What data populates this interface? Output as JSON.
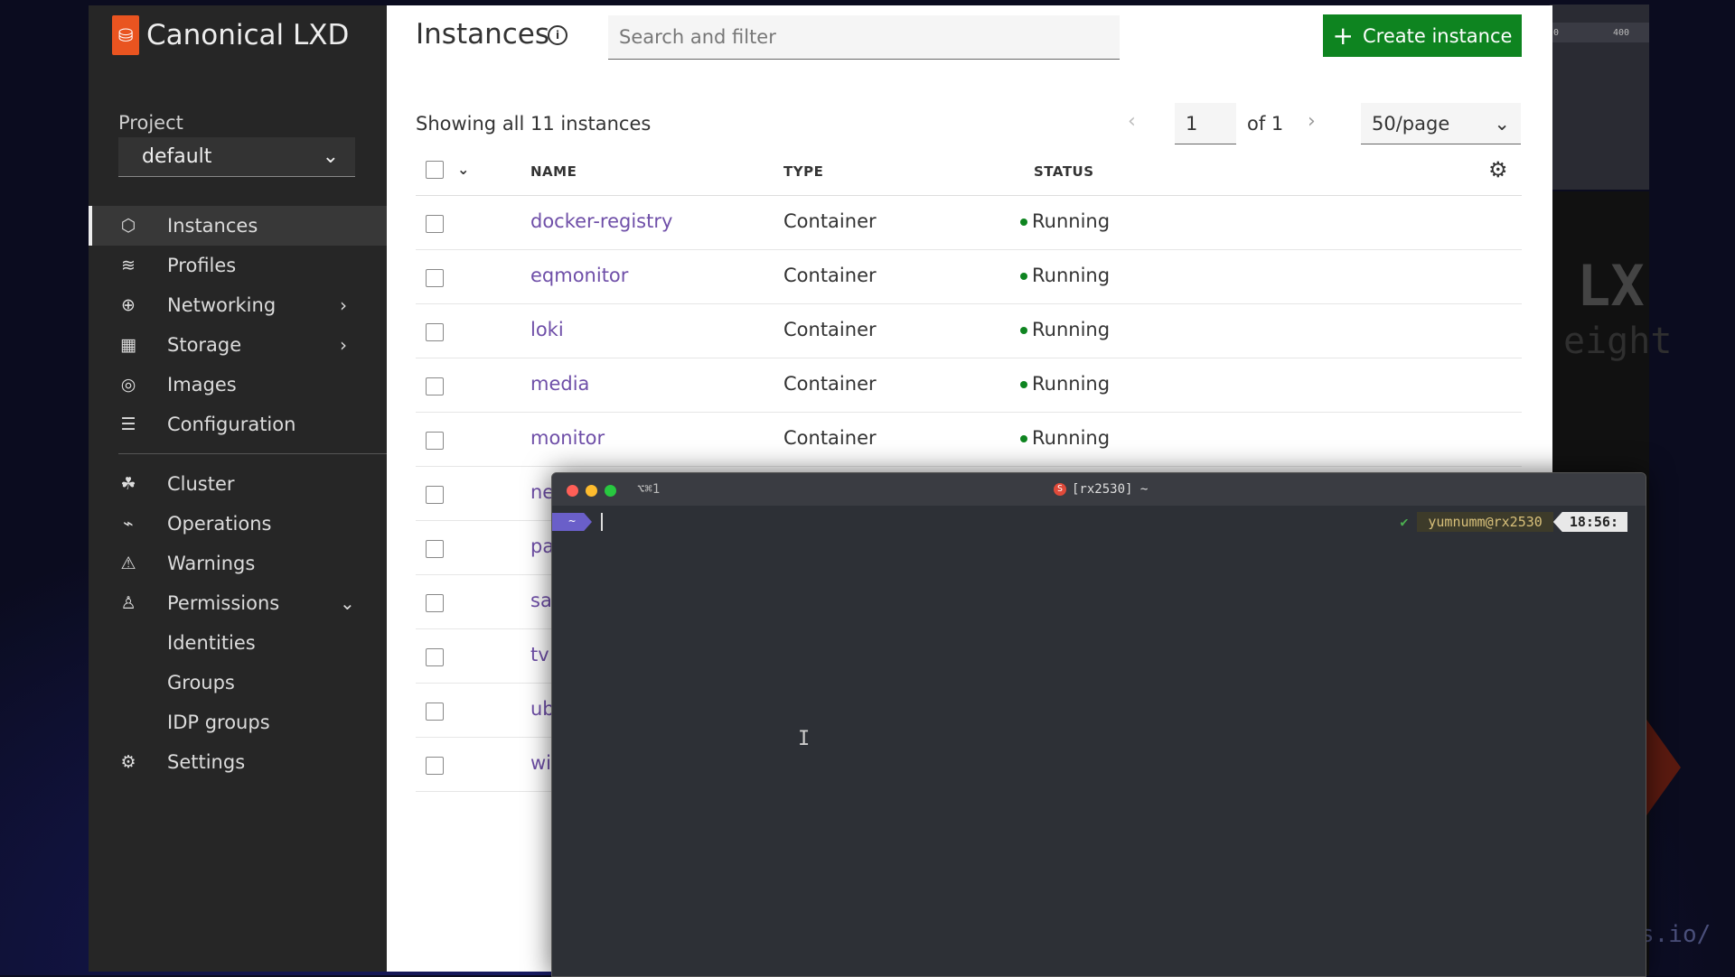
{
  "sidebar": {
    "brand": "Canonical LXD",
    "project_label": "Project",
    "project_value": "default",
    "items": [
      {
        "label": "Instances",
        "icon": "instances-icon",
        "glyph": "⬡",
        "active": true
      },
      {
        "label": "Profiles",
        "icon": "profiles-icon",
        "glyph": "≋"
      },
      {
        "label": "Networking",
        "icon": "networking-icon",
        "glyph": "⊕",
        "chevron": "›"
      },
      {
        "label": "Storage",
        "icon": "storage-icon",
        "glyph": "▦",
        "chevron": "›"
      },
      {
        "label": "Images",
        "icon": "images-icon",
        "glyph": "◎"
      },
      {
        "label": "Configuration",
        "icon": "configuration-icon",
        "glyph": "☰"
      },
      {
        "label": "Cluster",
        "icon": "cluster-icon",
        "glyph": "☘"
      },
      {
        "label": "Operations",
        "icon": "operations-icon",
        "glyph": "⌁"
      },
      {
        "label": "Warnings",
        "icon": "warnings-icon",
        "glyph": "⚠"
      },
      {
        "label": "Permissions",
        "icon": "permissions-icon",
        "glyph": "♙",
        "chevron": "⌄"
      },
      {
        "label": "Identities"
      },
      {
        "label": "Groups"
      },
      {
        "label": "IDP groups"
      },
      {
        "label": "Settings",
        "icon": "settings-icon",
        "glyph": "⚙"
      }
    ]
  },
  "main": {
    "title": "Instances",
    "search_placeholder": "Search and filter",
    "create_label": "Create instance",
    "showing": "Showing all 11 instances",
    "page_value": "1",
    "page_of": "of 1",
    "per_page": "50/page",
    "columns": [
      "NAME",
      "TYPE",
      "STATUS"
    ],
    "rows": [
      {
        "name": "docker-registry",
        "type": "Container",
        "status": "Running"
      },
      {
        "name": "eqmonitor",
        "type": "Container",
        "status": "Running"
      },
      {
        "name": "loki",
        "type": "Container",
        "status": "Running"
      },
      {
        "name": "media",
        "type": "Container",
        "status": "Running"
      },
      {
        "name": "monitor",
        "type": "Container",
        "status": "Running"
      },
      {
        "name": "ne",
        "type": "",
        "status": ""
      },
      {
        "name": "pa",
        "type": "",
        "status": ""
      },
      {
        "name": "sa",
        "type": "",
        "status": ""
      },
      {
        "name": "tv",
        "type": "",
        "status": ""
      },
      {
        "name": "ub",
        "type": "",
        "status": ""
      },
      {
        "name": "wi",
        "type": "",
        "status": ""
      }
    ]
  },
  "terminal": {
    "shortcut": "⌥⌘1",
    "title": "[rx2530] ~",
    "prompt_dir": "~",
    "user_host": "yumnumm@rx2530",
    "time": "18:56:"
  },
  "background": {
    "ruler_left": "0",
    "ruler_right": "400",
    "overlay_lx": "LX",
    "overlay_eight": "eight",
    "overlay_url": "s.io/"
  },
  "colors": {
    "brand": "#e95420",
    "create_button": "#0e8420",
    "link": "#6f4fa8",
    "running_dot": "#0e8420"
  }
}
